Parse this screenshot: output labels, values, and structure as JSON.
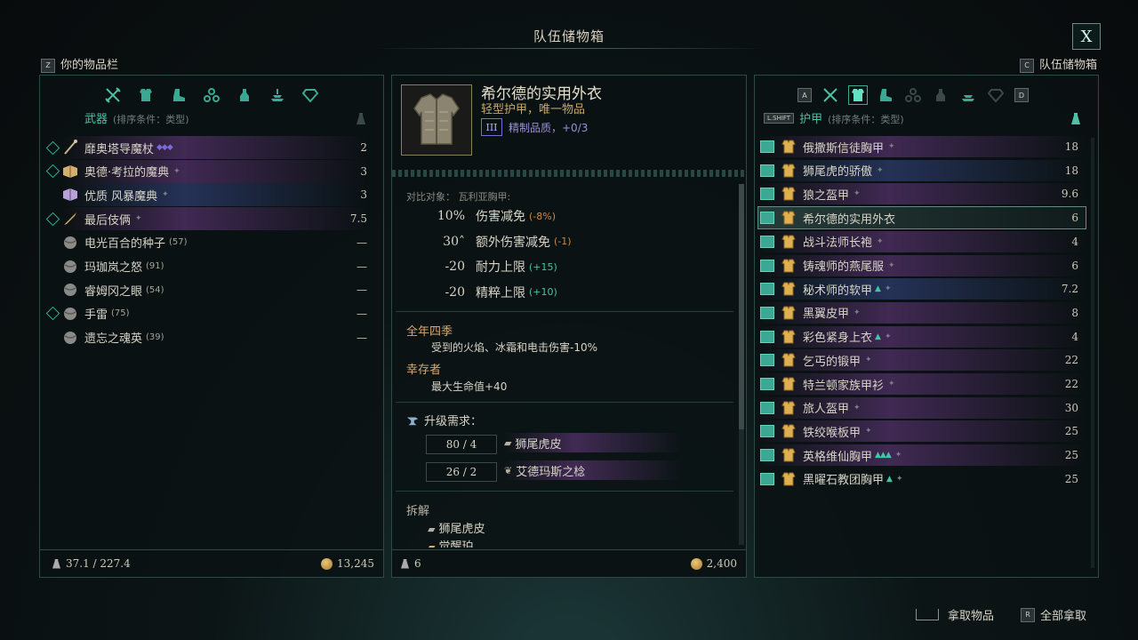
{
  "window": {
    "title": "队伍储物箱",
    "close_label": "X"
  },
  "header": {
    "left_key": "Z",
    "left_label": "你的物品栏",
    "right_key": "C",
    "right_label": "队伍储物箱"
  },
  "left_panel": {
    "category_label": "武器",
    "sort_label": "(排序条件：类型)",
    "items": [
      {
        "name": "靡奥塔导魔杖",
        "value": "2",
        "glow": "purple",
        "marker": true
      },
      {
        "name": "奥德·考拉的魔典",
        "value": "3",
        "glow": "purple",
        "marker": true
      },
      {
        "name": "优质 风暴魔典",
        "value": "3",
        "glow": "blue",
        "marker": false
      },
      {
        "name": "最后伎俩",
        "value": "7.5",
        "glow": "purple",
        "marker": true
      },
      {
        "name": "电光百合的种子",
        "count": "(57)",
        "value": "—",
        "glow": "none",
        "marker": false
      },
      {
        "name": "玛珈岚之怒",
        "count": "(91)",
        "value": "—",
        "glow": "none",
        "marker": false
      },
      {
        "name": "睿姆冈之眼",
        "count": "(54)",
        "value": "—",
        "glow": "none",
        "marker": false
      },
      {
        "name": "手雷",
        "count": "(75)",
        "value": "—",
        "glow": "none",
        "marker": true
      },
      {
        "name": "遗忘之魂英",
        "count": "(39)",
        "value": "—",
        "glow": "none",
        "marker": false
      }
    ],
    "footer_weight": "37.1 / 227.4",
    "footer_gold": "13,245"
  },
  "detail": {
    "item_name": "希尔德的实用外衣",
    "item_type": "轻型护甲，唯一物品",
    "tier": "III",
    "quality": "精制品质，+0/3",
    "compare_label": "对比对象： 瓦利亚胸甲:",
    "stats": [
      {
        "num": "10%",
        "label": "伤害减免",
        "diff": "(-8%)",
        "diff_class": "red"
      },
      {
        "num": "30˄",
        "label": "额外伤害减免",
        "diff": "(-1)",
        "diff_class": "red"
      },
      {
        "num": "-20",
        "label": "耐力上限",
        "diff": "(+15)",
        "diff_class": "green"
      },
      {
        "num": "-20",
        "label": "精粹上限",
        "diff": "(+10)",
        "diff_class": "green"
      }
    ],
    "perk1_title": "全年四季",
    "perk1_desc": "受到的火焰、冰霜和电击伤害-10%",
    "perk2_title": "幸存者",
    "perk2_desc": "最大生命值+40",
    "upgrade_label": "升级需求：",
    "requirements": [
      {
        "amount": "80 / 4",
        "name": "狮尾虎皮"
      },
      {
        "amount": "26 / 2",
        "name": "艾德玛斯之棯"
      }
    ],
    "dismantle_label": "拆解",
    "dismantle_items": [
      "狮尾虎皮",
      "觉醒珀"
    ],
    "footer_weight": "6",
    "footer_gold": "2,400"
  },
  "right_panel": {
    "key_a": "A",
    "key_d": "D",
    "shift_key": "L.SHIFT",
    "category_label": "护甲",
    "sort_label": "(排序条件：类型)",
    "items": [
      {
        "name": "俄撒斯信徒胸甲",
        "value": "18",
        "glow": "purple"
      },
      {
        "name": "狮尾虎的骄傲",
        "value": "18",
        "glow": "blue"
      },
      {
        "name": "狼之盔甲",
        "value": "9.6",
        "glow": "purple"
      },
      {
        "name": "希尔德的实用外衣",
        "value": "6",
        "glow": "selected"
      },
      {
        "name": "战斗法师长袍",
        "value": "4",
        "glow": "purple"
      },
      {
        "name": "铸魂师的燕尾服",
        "value": "6",
        "glow": "purple"
      },
      {
        "name": "秘术师的软甲",
        "value": "7.2",
        "glow": "blue"
      },
      {
        "name": "黑翼皮甲",
        "value": "8",
        "glow": "purple"
      },
      {
        "name": "彩色紧身上衣",
        "value": "4",
        "glow": "purple"
      },
      {
        "name": "乞丐的锻甲",
        "value": "22",
        "glow": "purple"
      },
      {
        "name": "特兰顿家族甲衫",
        "value": "22",
        "glow": "purple"
      },
      {
        "name": "旅人盔甲",
        "value": "30",
        "glow": "purple"
      },
      {
        "name": "铁绞喉板甲",
        "value": "25",
        "glow": "purple"
      },
      {
        "name": "英格维仙胸甲",
        "value": "25",
        "glow": "purple"
      },
      {
        "name": "黑曜石教团胸甲",
        "value": "25",
        "glow": "none"
      }
    ]
  },
  "bottom": {
    "take_label": "拿取物品",
    "take_all_key": "R",
    "take_all_label": "全部拿取"
  },
  "colors": {
    "accent": "#4fbfa5",
    "gold": "#d6a870",
    "border": "#2c4a47"
  }
}
